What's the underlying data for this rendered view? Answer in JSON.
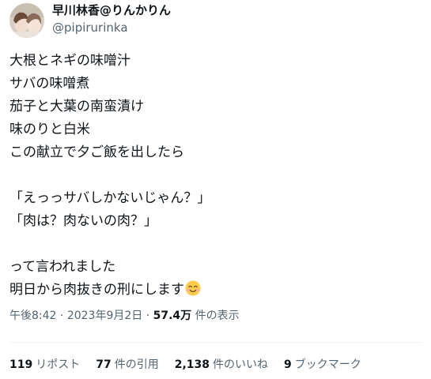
{
  "user": {
    "display_name": "早川林香@りんかりん",
    "handle": "@pipirurinka"
  },
  "tweet": {
    "lines": [
      "大根とネギの味噌汁",
      "サバの味噌煮",
      "茄子と大葉の南蛮漬け",
      "味のりと白米",
      "この献立で夕ご飯を出したら",
      "",
      "「えっっサバしかないじゃん？」",
      "「肉は？肉ないの肉？」",
      "",
      "って言われました",
      "明日から肉抜きの刑にします"
    ],
    "emoji": "smiling-face-icon"
  },
  "meta": {
    "time": "午後8:42",
    "separator": "·",
    "date": "2023年9月2日",
    "views": "57.4万",
    "views_label": "件の表示"
  },
  "stats": [
    {
      "count": "119",
      "label": "リポスト"
    },
    {
      "count": "77",
      "label": "件の引用"
    },
    {
      "count": "2,138",
      "label": "件のいいね"
    },
    {
      "count": "9",
      "label": "ブックマーク"
    }
  ]
}
